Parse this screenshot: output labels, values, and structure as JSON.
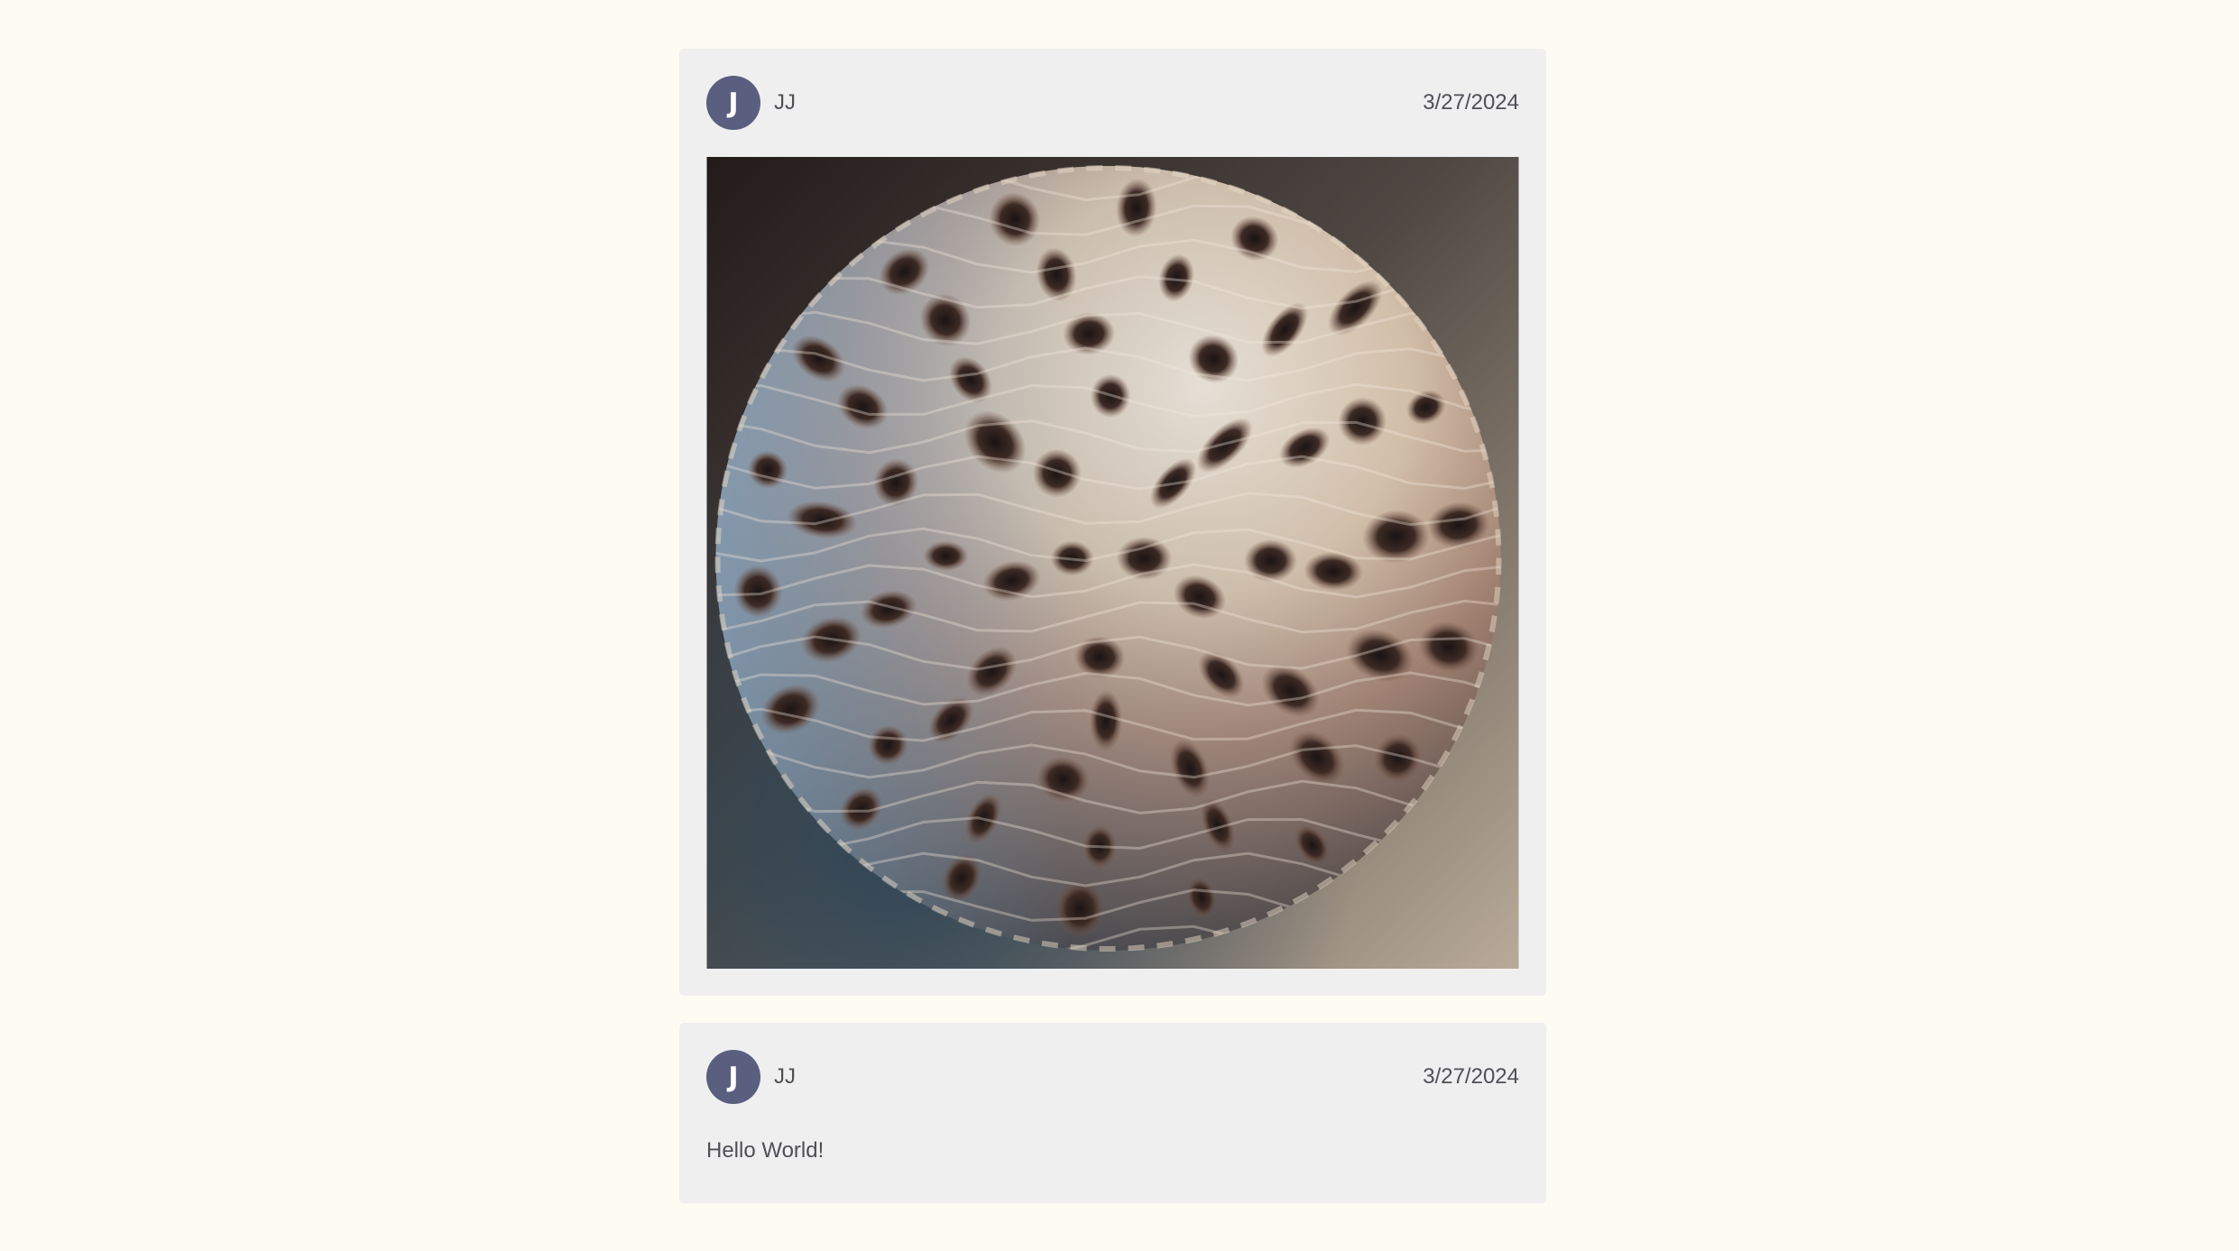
{
  "posts": [
    {
      "author": "JJ",
      "avatar_initial": "J",
      "date": "3/27/2024",
      "image": {
        "icon": "fractal-sphere-image",
        "colors": {
          "background_dark": "#2a2220",
          "background_light": "#b9aa98",
          "shadow_blue": "#2e4658",
          "ridge_light": "#e8dccd",
          "ridge_blue": "#9ab4cc",
          "ridge_brown": "#9a6a52"
        }
      }
    },
    {
      "author": "JJ",
      "avatar_initial": "J",
      "date": "3/27/2024",
      "text": "Hello World!"
    }
  ],
  "colors": {
    "page_background": "#fcfcf3",
    "card_background": "#efeff0",
    "avatar_background": "#5a5f7f",
    "text": "#4f4f55"
  }
}
